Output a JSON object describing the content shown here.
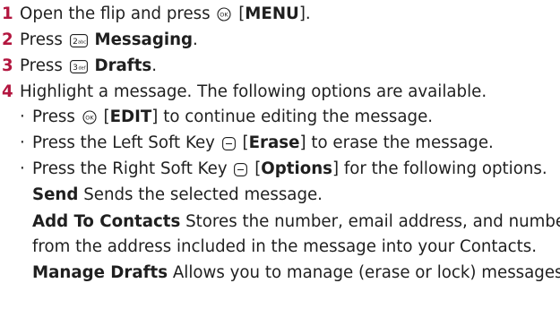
{
  "steps": [
    {
      "num": "1",
      "prefix": "Open the flip and press",
      "key_icon": "ok-key-icon",
      "key_label": "MENU",
      "suffix": "."
    },
    {
      "num": "2",
      "prefix": "Press",
      "key_icon": "number-2-key-icon",
      "key_label": "Messaging",
      "suffix": "."
    },
    {
      "num": "3",
      "prefix": "Press",
      "key_icon": "number-3-key-icon",
      "key_label": "Drafts",
      "suffix": "."
    },
    {
      "num": "4",
      "text": "Highlight a message. The following options are available."
    }
  ],
  "bullets": [
    {
      "prefix": "Press",
      "key_icon": "ok-key-icon",
      "key_label": "EDIT",
      "suffix": "to continue editing the message."
    },
    {
      "prefix": "Press the Left Soft Key",
      "key_icon": "left-soft-key-icon",
      "key_label": "Erase",
      "suffix": "to erase the message."
    },
    {
      "prefix": "Press the Right Soft Key",
      "key_icon": "right-soft-key-icon",
      "key_label": "Options",
      "suffix": "for the following options."
    }
  ],
  "options": [
    {
      "term": "Send",
      "desc": "Sends the selected message."
    },
    {
      "term": "Add To Contacts",
      "desc": "Stores the number, email address, and numbers",
      "desc_cont": "from the address included in the message into your Contacts."
    },
    {
      "term": "Manage Drafts",
      "desc": "Allows you to manage (erase or lock) messages."
    }
  ],
  "colors": {
    "step_number": "#b3163f",
    "text": "#1f1f1f"
  }
}
